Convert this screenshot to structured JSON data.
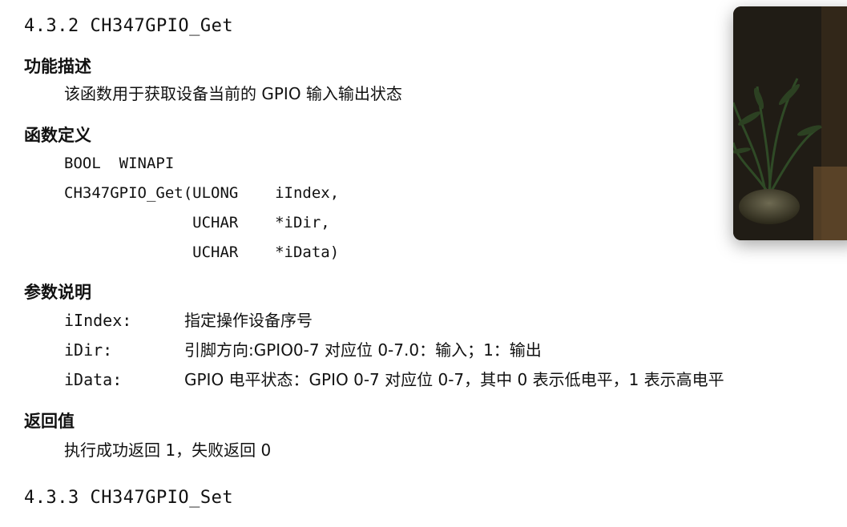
{
  "section_current": {
    "title": "4.3.2 CH347GPIO_Get"
  },
  "function_desc": {
    "heading": "功能描述",
    "text": "该函数用于获取设备当前的 GPIO 输入输出状态"
  },
  "function_def": {
    "heading": "函数定义",
    "lines": [
      "BOOL  WINAPI",
      "CH347GPIO_Get(ULONG    iIndex,",
      "              UCHAR    *iDir,",
      "              UCHAR    *iData)"
    ]
  },
  "params": {
    "heading": "参数说明",
    "items": [
      {
        "name": "iIndex:",
        "desc": "指定操作设备序号"
      },
      {
        "name": "iDir:",
        "desc": "引脚方向:GPIO0-7 对应位 0-7.0：输入；1：输出"
      },
      {
        "name": "iData:",
        "desc": "GPIO 电平状态：GPIO 0-7 对应位 0-7，其中 0 表示低电平，1 表示高电平"
      }
    ]
  },
  "return_value": {
    "heading": "返回值",
    "text": "执行成功返回 1，失败返回 0"
  },
  "section_next": {
    "title": "4.3.3 CH347GPIO_Set"
  }
}
